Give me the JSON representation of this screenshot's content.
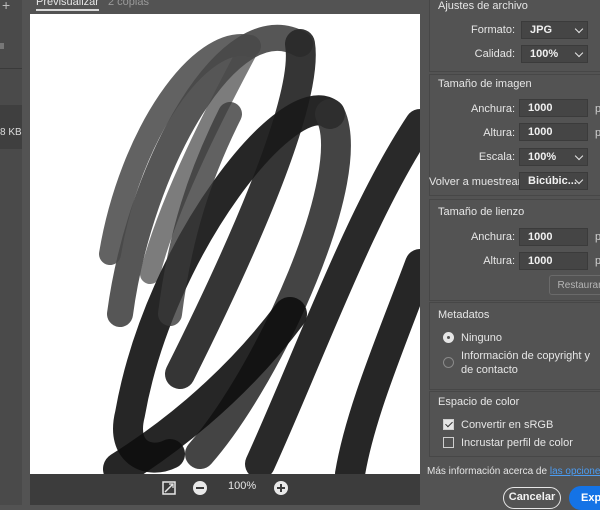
{
  "left_strip": {
    "size_label": "8 KB"
  },
  "tabs": [
    {
      "label": "Previsualizar"
    },
    {
      "label": "2 copias"
    }
  ],
  "zoom": {
    "level": "100%"
  },
  "file_settings": {
    "title": "Ajustes de archivo",
    "format_label": "Formato:",
    "format_value": "JPG",
    "quality_label": "Calidad:",
    "quality_value": "100%"
  },
  "image_size": {
    "title": "Tamaño de imagen",
    "width_label": "Anchura:",
    "width_value": "1000",
    "height_label": "Altura:",
    "height_value": "1000",
    "unit": "p",
    "scale_label": "Escala:",
    "scale_value": "100%",
    "resample_label": "Volver a muestrear:",
    "resample_value": "Bicúbic..."
  },
  "canvas_size": {
    "title": "Tamaño de lienzo",
    "width_label": "Anchura:",
    "width_value": "1000",
    "height_label": "Altura:",
    "height_value": "1000",
    "unit": "p",
    "restore_label": "Restaurar"
  },
  "metadata": {
    "title": "Metadatos",
    "options": [
      {
        "label": "Ninguno",
        "selected": true
      },
      {
        "label": "Información de copyright y de contacto",
        "selected": false
      }
    ]
  },
  "color_space": {
    "title": "Espacio de color",
    "options": [
      {
        "label": "Convertir en sRGB",
        "checked": true
      },
      {
        "label": "Incrustar perfil de color",
        "checked": false
      }
    ]
  },
  "footer": {
    "more_info": "Más información acerca de",
    "link": "las opciones de",
    "cancel_label": "Cancelar",
    "export_label": "Exportar"
  },
  "colors": {
    "accent": "#1473e6",
    "panel_bg": "#535353",
    "canvas_bg": "#ffffff",
    "link": "#4b9cf2"
  }
}
